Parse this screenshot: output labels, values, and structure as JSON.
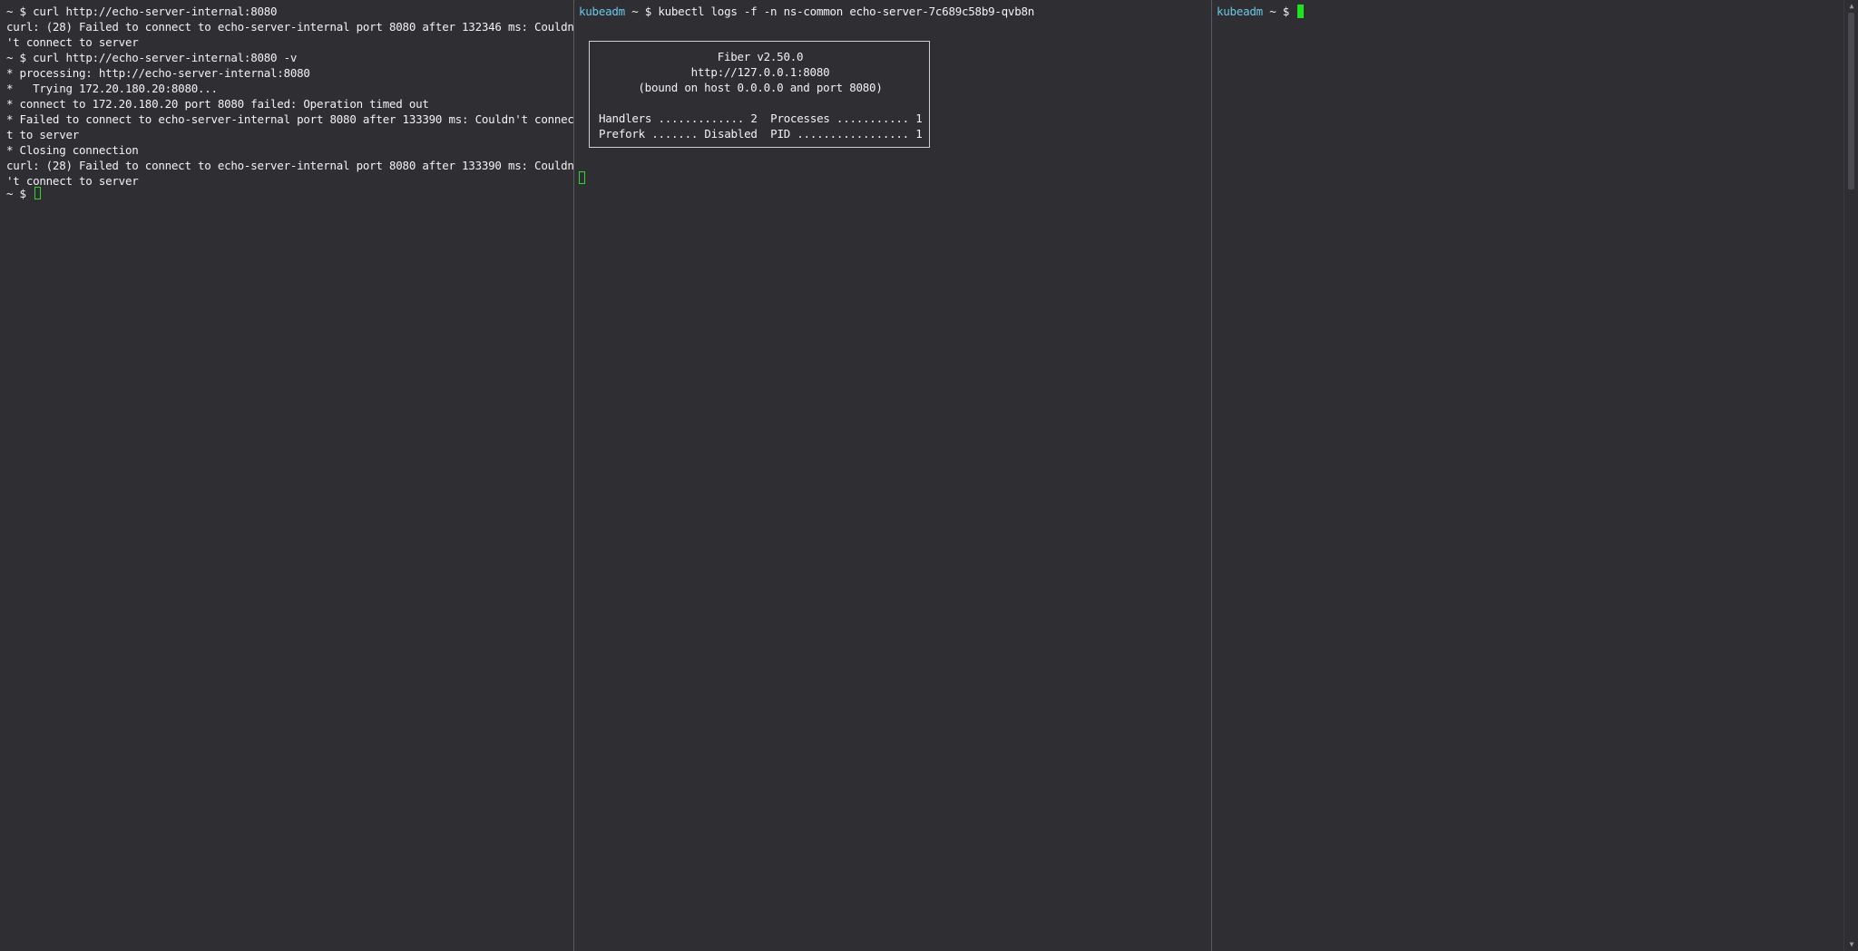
{
  "left_pane": {
    "lines": [
      {
        "prompt": "~ $ ",
        "text": "curl http://echo-server-internal:8080"
      },
      {
        "text": "curl: (28) Failed to connect to echo-server-internal port 8080 after 132346 ms: Couldn"
      },
      {
        "text": "'t connect to server"
      },
      {
        "prompt": "~ $ ",
        "text": "curl http://echo-server-internal:8080 -v"
      },
      {
        "text": "* processing: http://echo-server-internal:8080"
      },
      {
        "text": "*   Trying 172.20.180.20:8080..."
      },
      {
        "text": "* connect to 172.20.180.20 port 8080 failed: Operation timed out"
      },
      {
        "text": "* Failed to connect to echo-server-internal port 8080 after 133390 ms: Couldn't connec"
      },
      {
        "text": "t to server"
      },
      {
        "text": "* Closing connection"
      },
      {
        "text": "curl: (28) Failed to connect to echo-server-internal port 8080 after 133390 ms: Couldn"
      },
      {
        "text": "'t connect to server"
      }
    ],
    "current_prompt": "~ $ "
  },
  "middle_pane": {
    "prompt_user": "kubeadm",
    "prompt_symbol": " ~ $ ",
    "command": "kubectl logs -f -n ns-common echo-server-7c689c58b9-qvb8n",
    "banner": {
      "title": "Fiber v2.50.0",
      "url": "http://127.0.0.1:8080",
      "bound": "(bound on host 0.0.0.0 and port 8080)",
      "row1": "Handlers ............. 2  Processes ........... 1",
      "row2": "Prefork ....... Disabled  PID ................. 1"
    }
  },
  "right_pane": {
    "prompt_user": "kubeadm",
    "prompt_symbol": " ~ $ "
  },
  "colors": {
    "background": "#2f2f33",
    "prompt_user": "#6cc6e8",
    "cursor": "#1ee31e",
    "text": "#f2f2f2"
  }
}
